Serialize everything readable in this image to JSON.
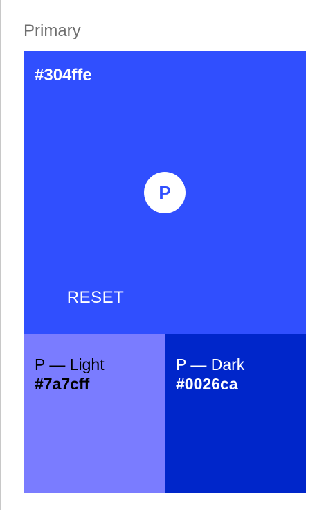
{
  "section": {
    "title": "Primary"
  },
  "primary": {
    "hex_label": "#304ffe",
    "color": "#304ffe",
    "badge_letter": "P",
    "reset_label": "RESET"
  },
  "light": {
    "label": "P — Light",
    "hex_label": "#7a7cff",
    "color": "#7a7cff",
    "text_color": "#000000"
  },
  "dark": {
    "label": "P — Dark",
    "hex_label": "#0026ca",
    "color": "#0026ca",
    "text_color": "#ffffff"
  }
}
